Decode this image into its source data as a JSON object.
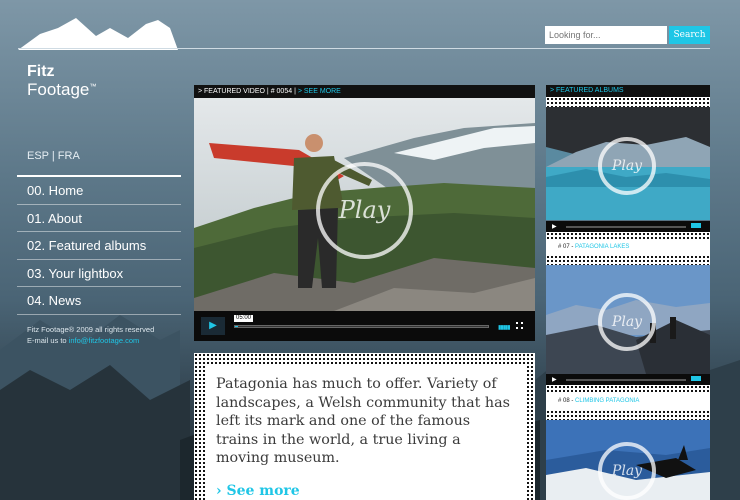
{
  "brand": {
    "line1": "Fitz",
    "line2": "Footage",
    "mark": "™"
  },
  "search": {
    "placeholder": "Looking for...",
    "button": "Search"
  },
  "lang": {
    "esp": "ESP",
    "sep": "|",
    "fra": "FRA"
  },
  "nav": [
    {
      "label": "00. Home"
    },
    {
      "label": "01. About"
    },
    {
      "label": "02. Featured albums"
    },
    {
      "label": "03. Your lightbox"
    },
    {
      "label": "04. News"
    }
  ],
  "footer": {
    "copyright": "Fitz Footage® 2009 all rights reserved",
    "email_prefix": "E-mail us to ",
    "email": "info@fitzfootage.com"
  },
  "featured_video": {
    "label": "> FEATURED VIDEO",
    "sep1": "|",
    "number": "# 0054",
    "sep2": "|",
    "see_more": "> SEE MORE",
    "play_text": "Play",
    "time": "05:00",
    "progress": 0.01
  },
  "description": {
    "text": "Patagonia has much to offer. Variety of landscapes, a Welsh community that has left its mark and one of the famous trains in the world, a true living a moving museum.",
    "see_more": "› See more"
  },
  "featured_albums": {
    "label": "> FEATURED ALBUMS",
    "albums": [
      {
        "number": "# 07 -",
        "title": "PATAGONIA LAKES",
        "play_text": "Play"
      },
      {
        "number": "# 08 -",
        "title": "CLIMBING PATAGONIA",
        "play_text": "Play"
      },
      {
        "number": "",
        "title": "",
        "play_text": "Play"
      }
    ]
  },
  "colors": {
    "accent": "#1fc6e6",
    "bar": "#111111"
  }
}
